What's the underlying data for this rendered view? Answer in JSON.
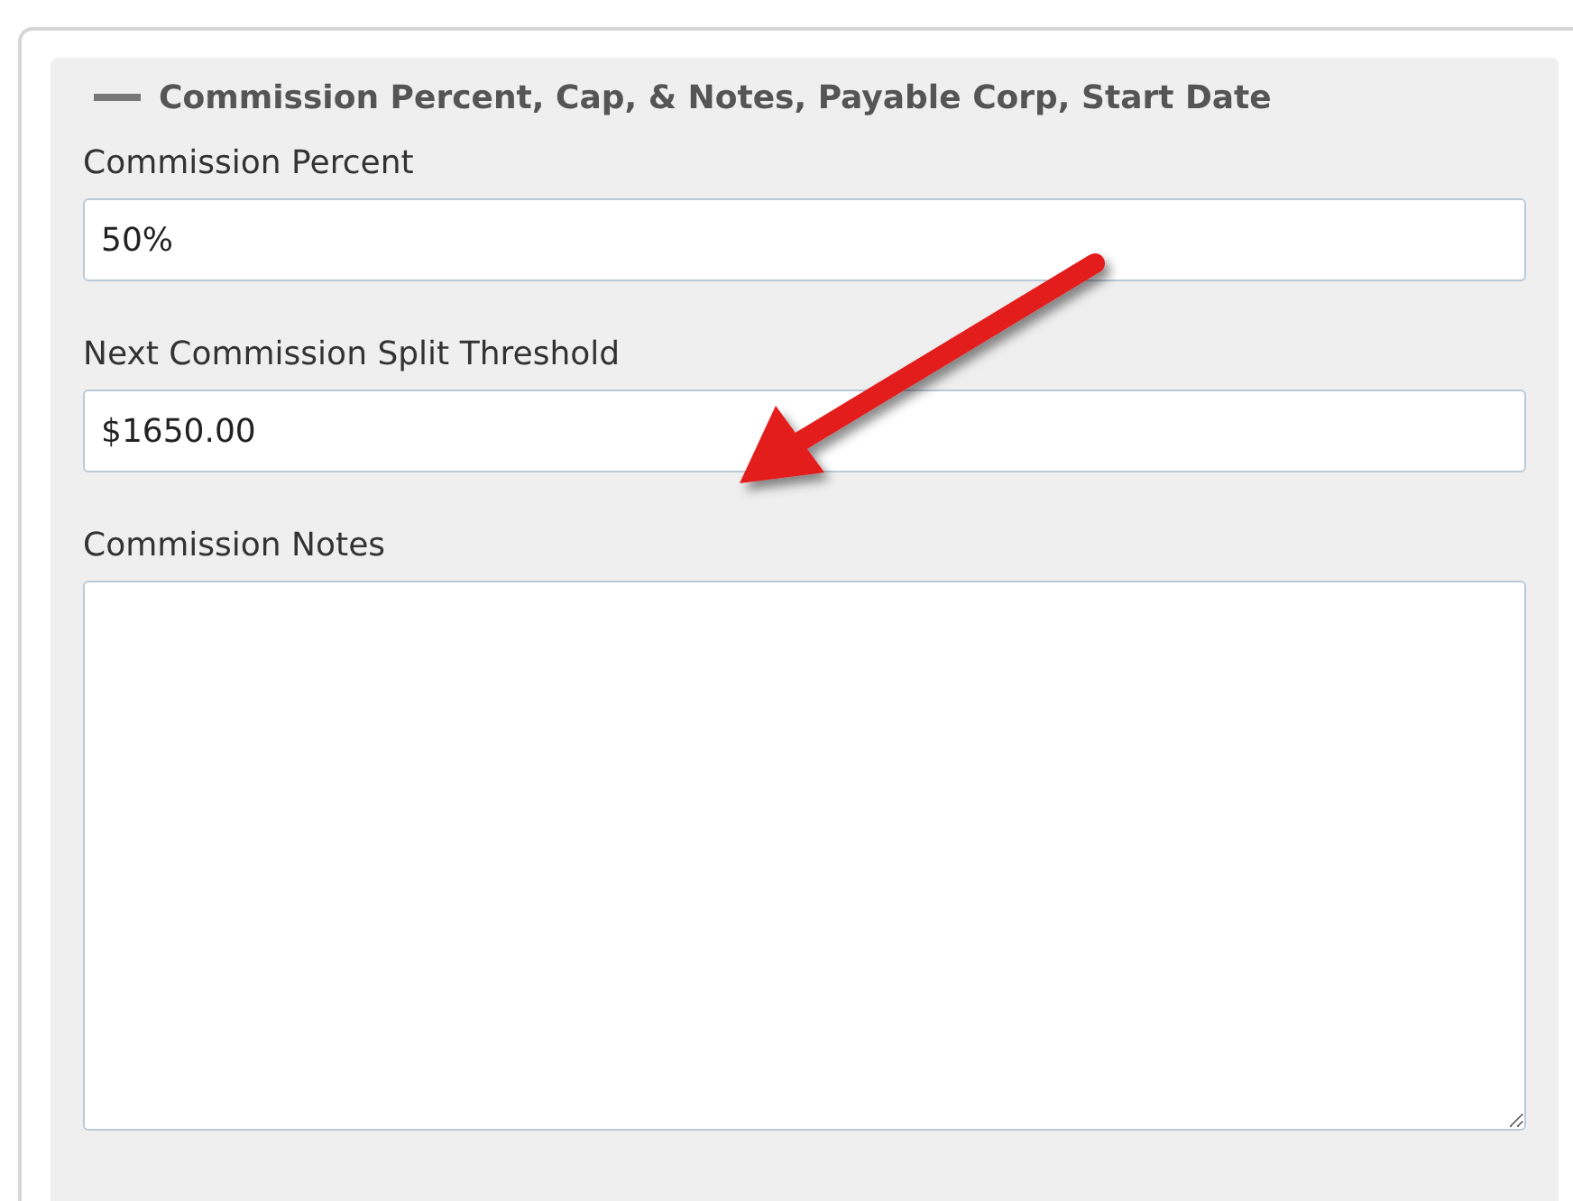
{
  "section": {
    "title": "Commission Percent, Cap, & Notes, Payable Corp, Start Date",
    "fields": [
      {
        "label": "Commission Percent",
        "value": "50%",
        "kind": "input"
      },
      {
        "label": "Next Commission Split Threshold",
        "value": "$1650.00",
        "kind": "input"
      },
      {
        "label": "Commission Notes",
        "kind": "textarea"
      }
    ]
  }
}
